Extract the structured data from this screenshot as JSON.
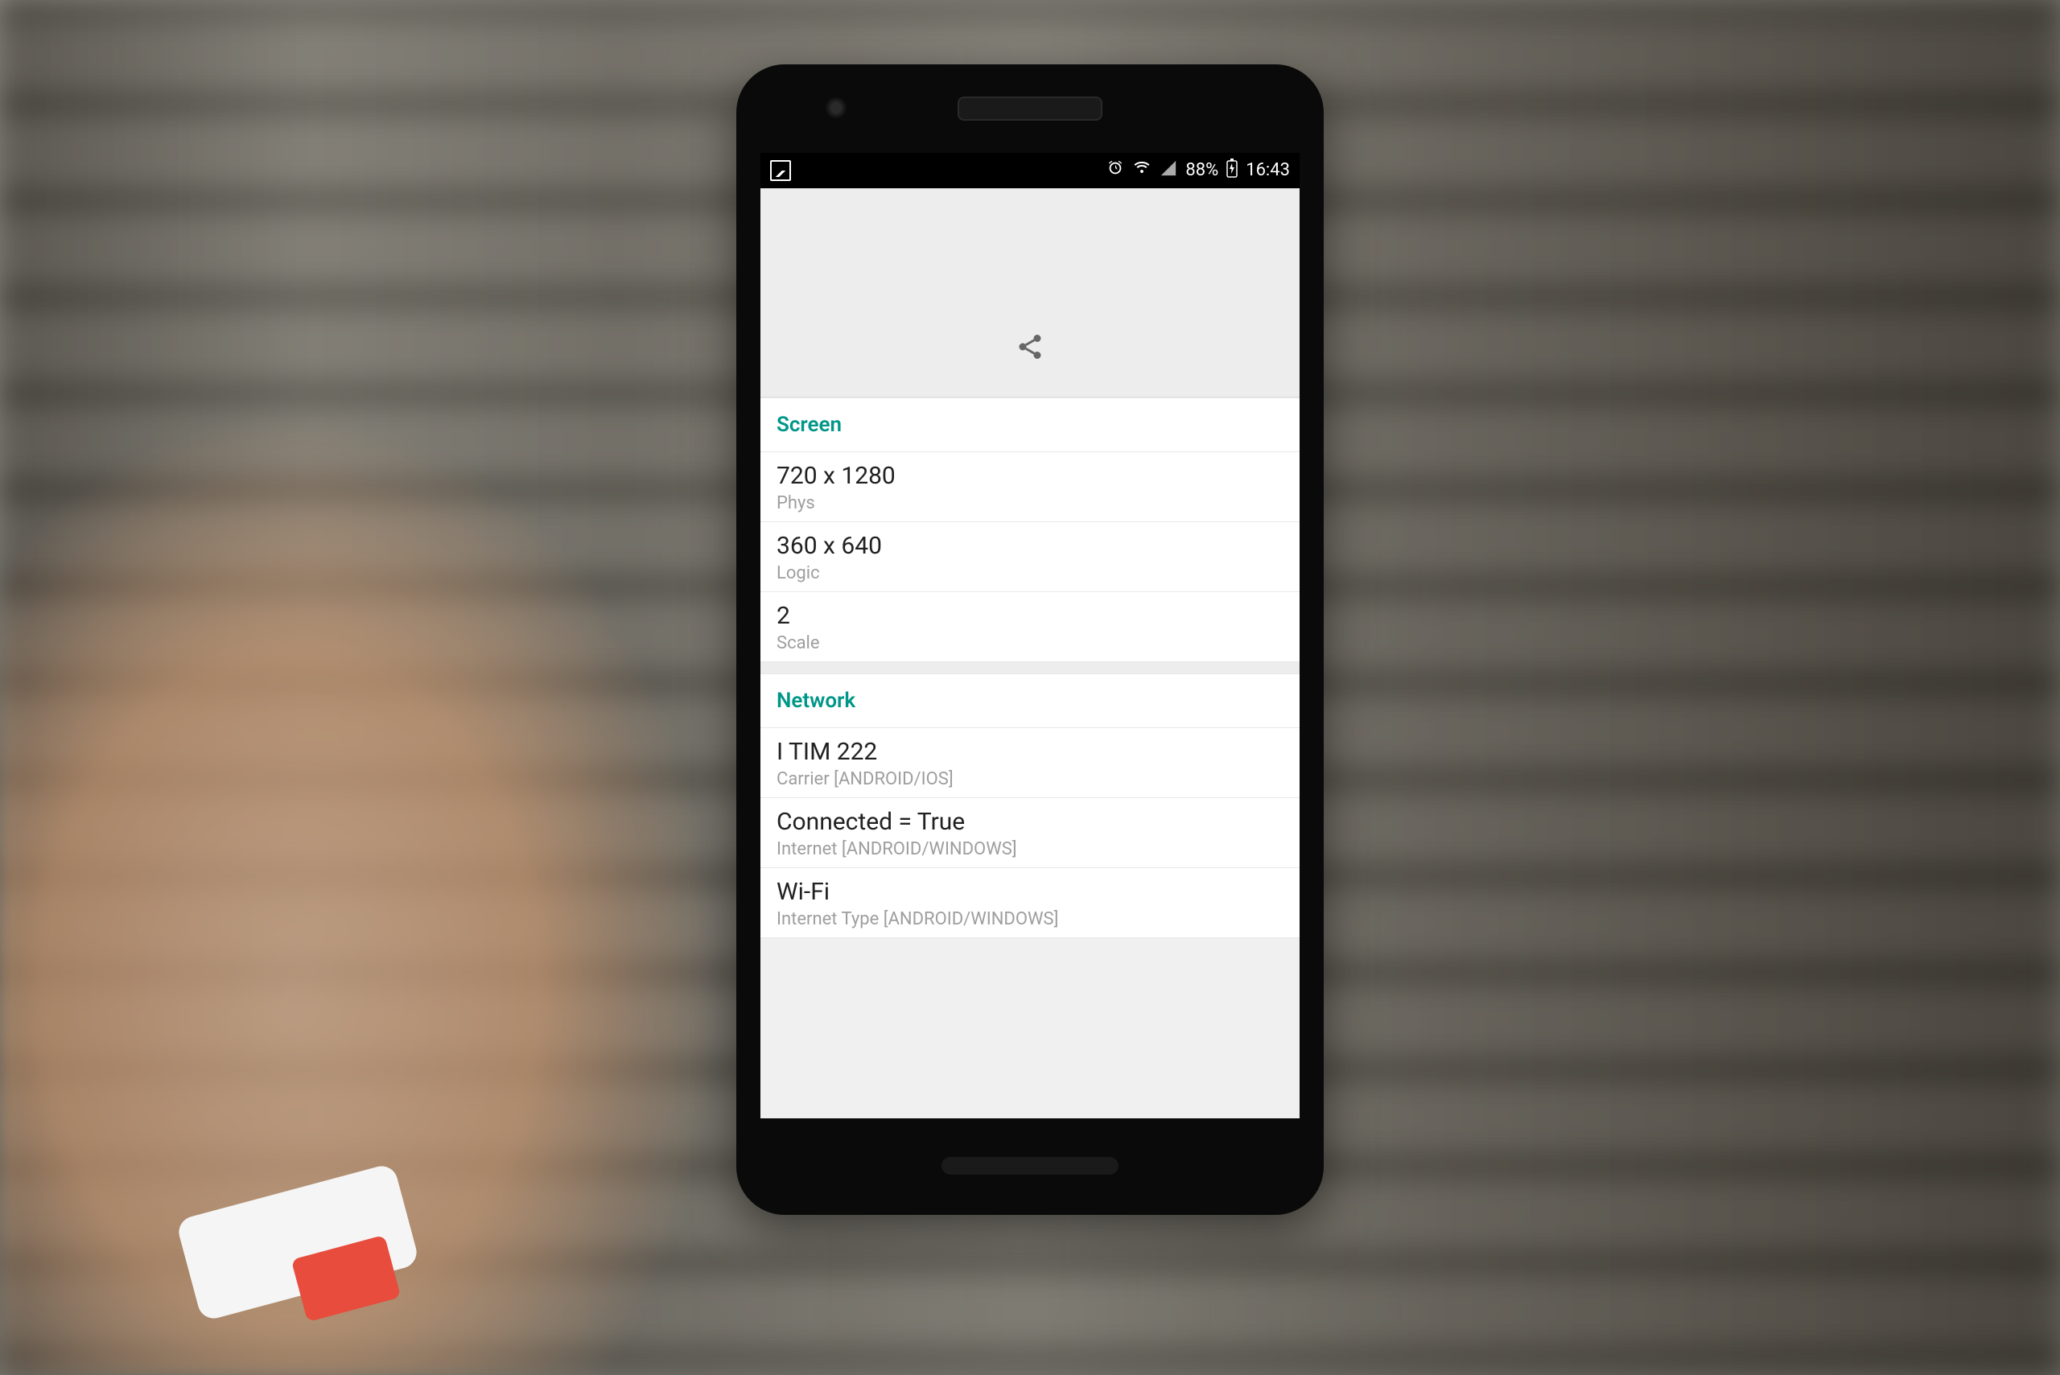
{
  "statusBar": {
    "battery": "88%",
    "time": "16:43"
  },
  "sections": {
    "screen": {
      "title": "Screen",
      "items": [
        {
          "value": "720 x 1280",
          "label": "Phys"
        },
        {
          "value": "360 x 640",
          "label": "Logic"
        },
        {
          "value": "2",
          "label": "Scale"
        }
      ]
    },
    "network": {
      "title": "Network",
      "items": [
        {
          "value": "I TIM 222",
          "label": "Carrier [ANDROID/IOS]"
        },
        {
          "value": "Connected = True",
          "label": "Internet [ANDROID/WINDOWS]"
        },
        {
          "value": "Wi-Fi",
          "label": "Internet Type [ANDROID/WINDOWS]"
        }
      ]
    }
  }
}
